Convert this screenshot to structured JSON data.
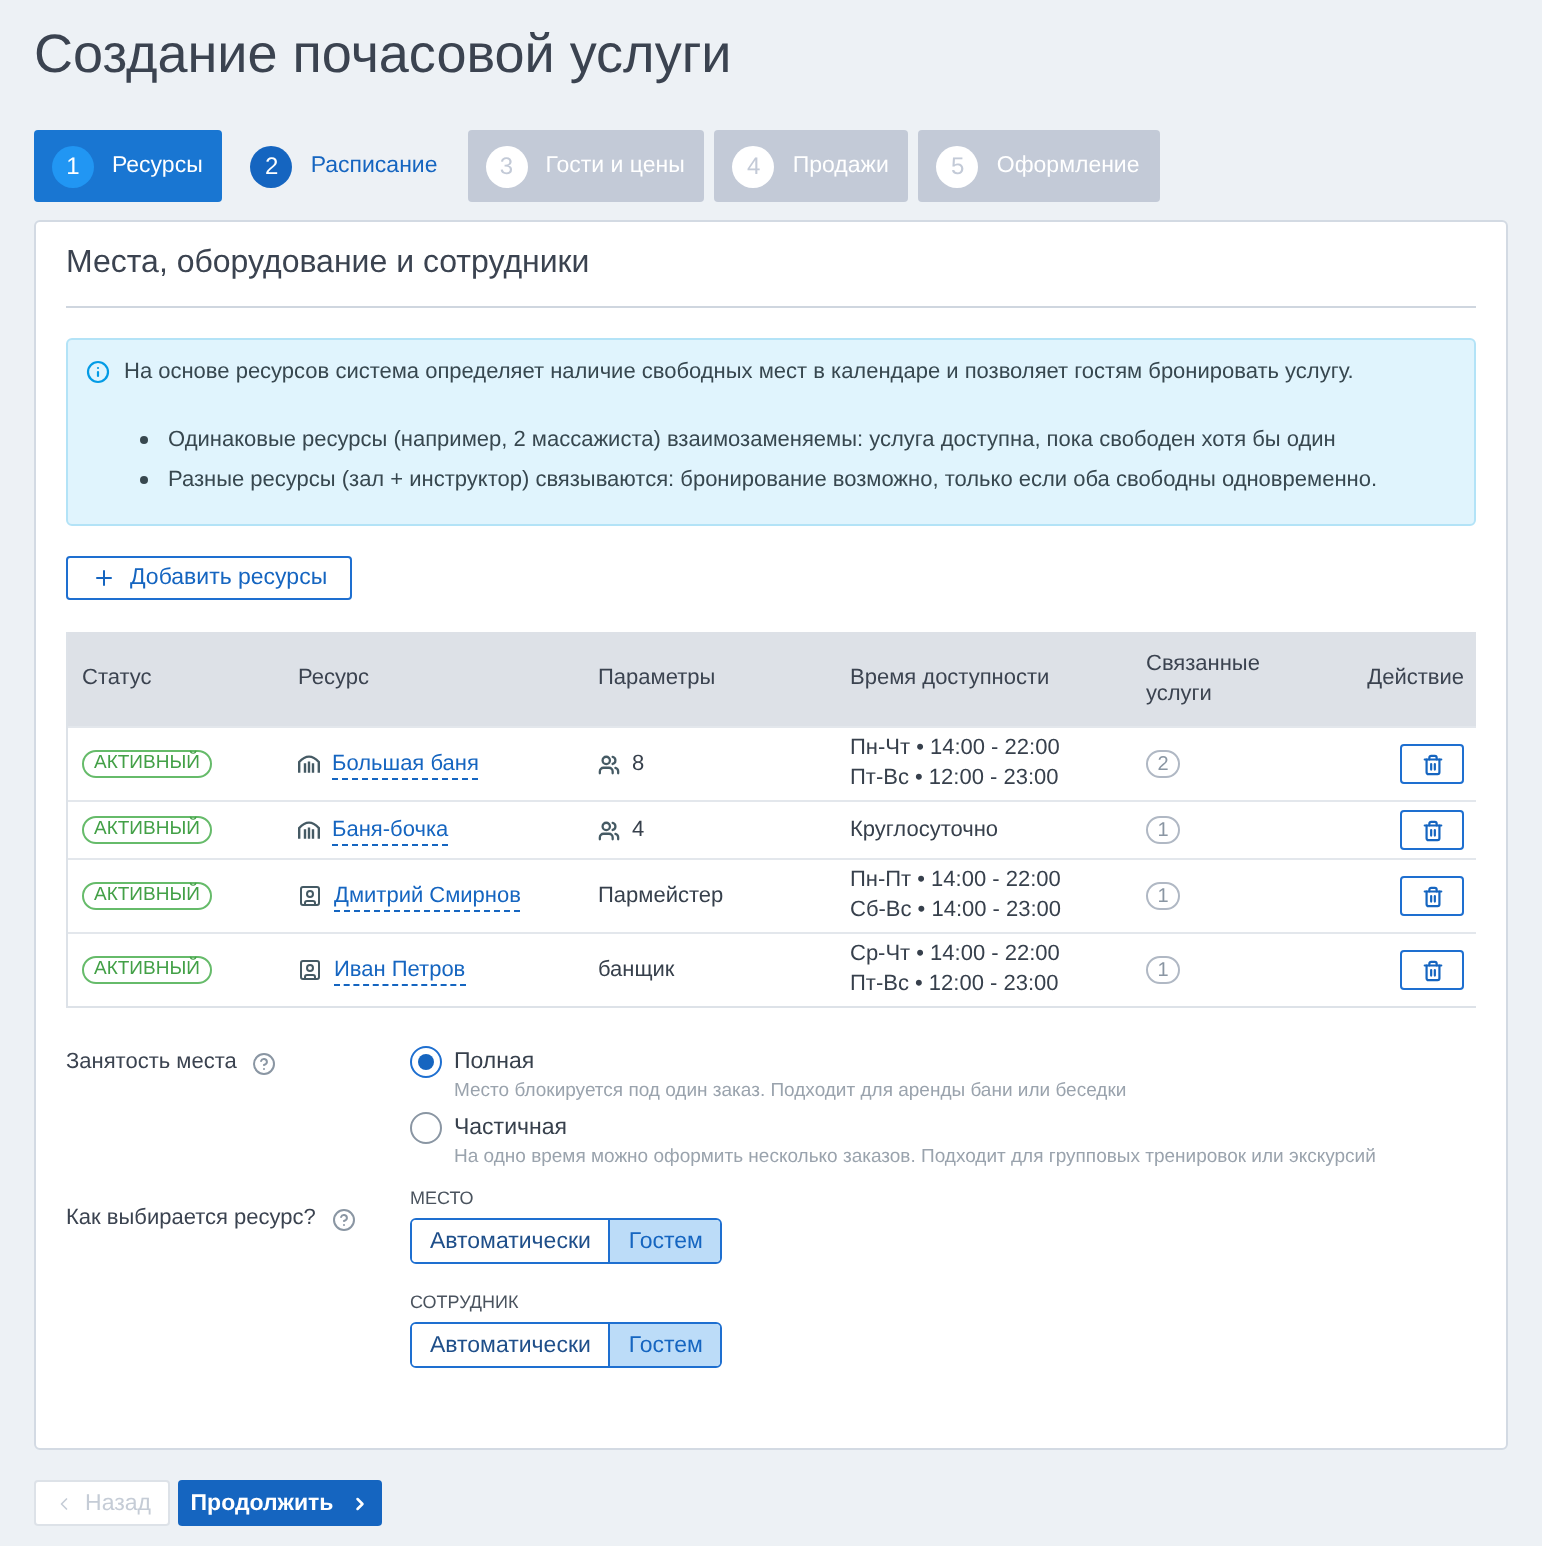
{
  "page": {
    "title": "Создание почасовой услуги"
  },
  "steps": [
    {
      "number": "1",
      "label": "Ресурсы",
      "selected": true,
      "disabled": false
    },
    {
      "number": "2",
      "label": "Расписание",
      "selected": false,
      "disabled": false
    },
    {
      "number": "3",
      "label": "Гости и цены",
      "selected": false,
      "disabled": true
    },
    {
      "number": "4",
      "label": "Продажи",
      "selected": false,
      "disabled": true
    },
    {
      "number": "5",
      "label": "Оформление",
      "selected": false,
      "disabled": true
    }
  ],
  "card": {
    "title": "Места, оборудование и сотрудники"
  },
  "info": {
    "text": "На основе ресурсов система определяет наличие свободных мест в календаре и позволяет гостям бронировать услугу.",
    "bullets": [
      "Одинаковые ресурсы (например, 2 массажиста) взаимозаменяемы: услуга доступна, пока свободен хотя бы один",
      "Разные ресурсы (зал + инструктор) связываются: бронирование возможно, только если оба свободны одновременно."
    ]
  },
  "add_button": {
    "label": "Добавить ресурсы"
  },
  "table": {
    "columns": [
      "Статус",
      "Ресурс",
      "Параметры",
      "Время доступности",
      "Связанные услуги",
      "Действие"
    ],
    "rows": [
      {
        "status": "АКТИВНЫЙ",
        "resource": {
          "kind": "place",
          "name": "Большая баня"
        },
        "params": {
          "kind": "capacity",
          "text": "8"
        },
        "availability": [
          "Пн-Чт • 14:00 - 22:00",
          "Пт-Вс • 12:00 - 23:00"
        ],
        "linked_services": "2"
      },
      {
        "status": "АКТИВНЫЙ",
        "resource": {
          "kind": "place",
          "name": "Баня-бочка"
        },
        "params": {
          "kind": "capacity",
          "text": "4"
        },
        "availability": [
          "Круглосуточно"
        ],
        "linked_services": "1"
      },
      {
        "status": "АКТИВНЫЙ",
        "resource": {
          "kind": "staff",
          "name": "Дмитрий Смирнов"
        },
        "params": {
          "kind": "text",
          "text": "Пармейстер"
        },
        "availability": [
          "Пн-Пт • 14:00 - 22:00",
          "Сб-Вс • 14:00 - 23:00"
        ],
        "linked_services": "1"
      },
      {
        "status": "АКТИВНЫЙ",
        "resource": {
          "kind": "staff",
          "name": "Иван Петров"
        },
        "params": {
          "kind": "text",
          "text": "банщик"
        },
        "availability": [
          "Ср-Чт • 14:00 - 22:00",
          "Пт-Вс • 12:00 - 23:00"
        ],
        "linked_services": "1"
      }
    ]
  },
  "occupancy": {
    "label": "Занятость места",
    "options": [
      {
        "label": "Полная",
        "description": "Место блокируется под один заказ. Подходит для аренды бани или беседки",
        "selected": true
      },
      {
        "label": "Частичная",
        "description": "На одно время можно оформить несколько заказов. Подходит для групповых тренировок или экскурсий",
        "selected": false
      }
    ]
  },
  "resource_choice": {
    "label": "Как выбирается ресурс?",
    "groups": [
      {
        "label": "МЕСТО",
        "options": [
          {
            "label": "Автоматически",
            "selected": false
          },
          {
            "label": "Гостем",
            "selected": true
          }
        ]
      },
      {
        "label": "СОТРУДНИК",
        "options": [
          {
            "label": "Автоматически",
            "selected": false
          },
          {
            "label": "Гостем",
            "selected": true
          }
        ]
      }
    ]
  },
  "footer": {
    "back": {
      "label": "Назад",
      "disabled": true
    },
    "next": {
      "label": "Продолжить"
    }
  }
}
